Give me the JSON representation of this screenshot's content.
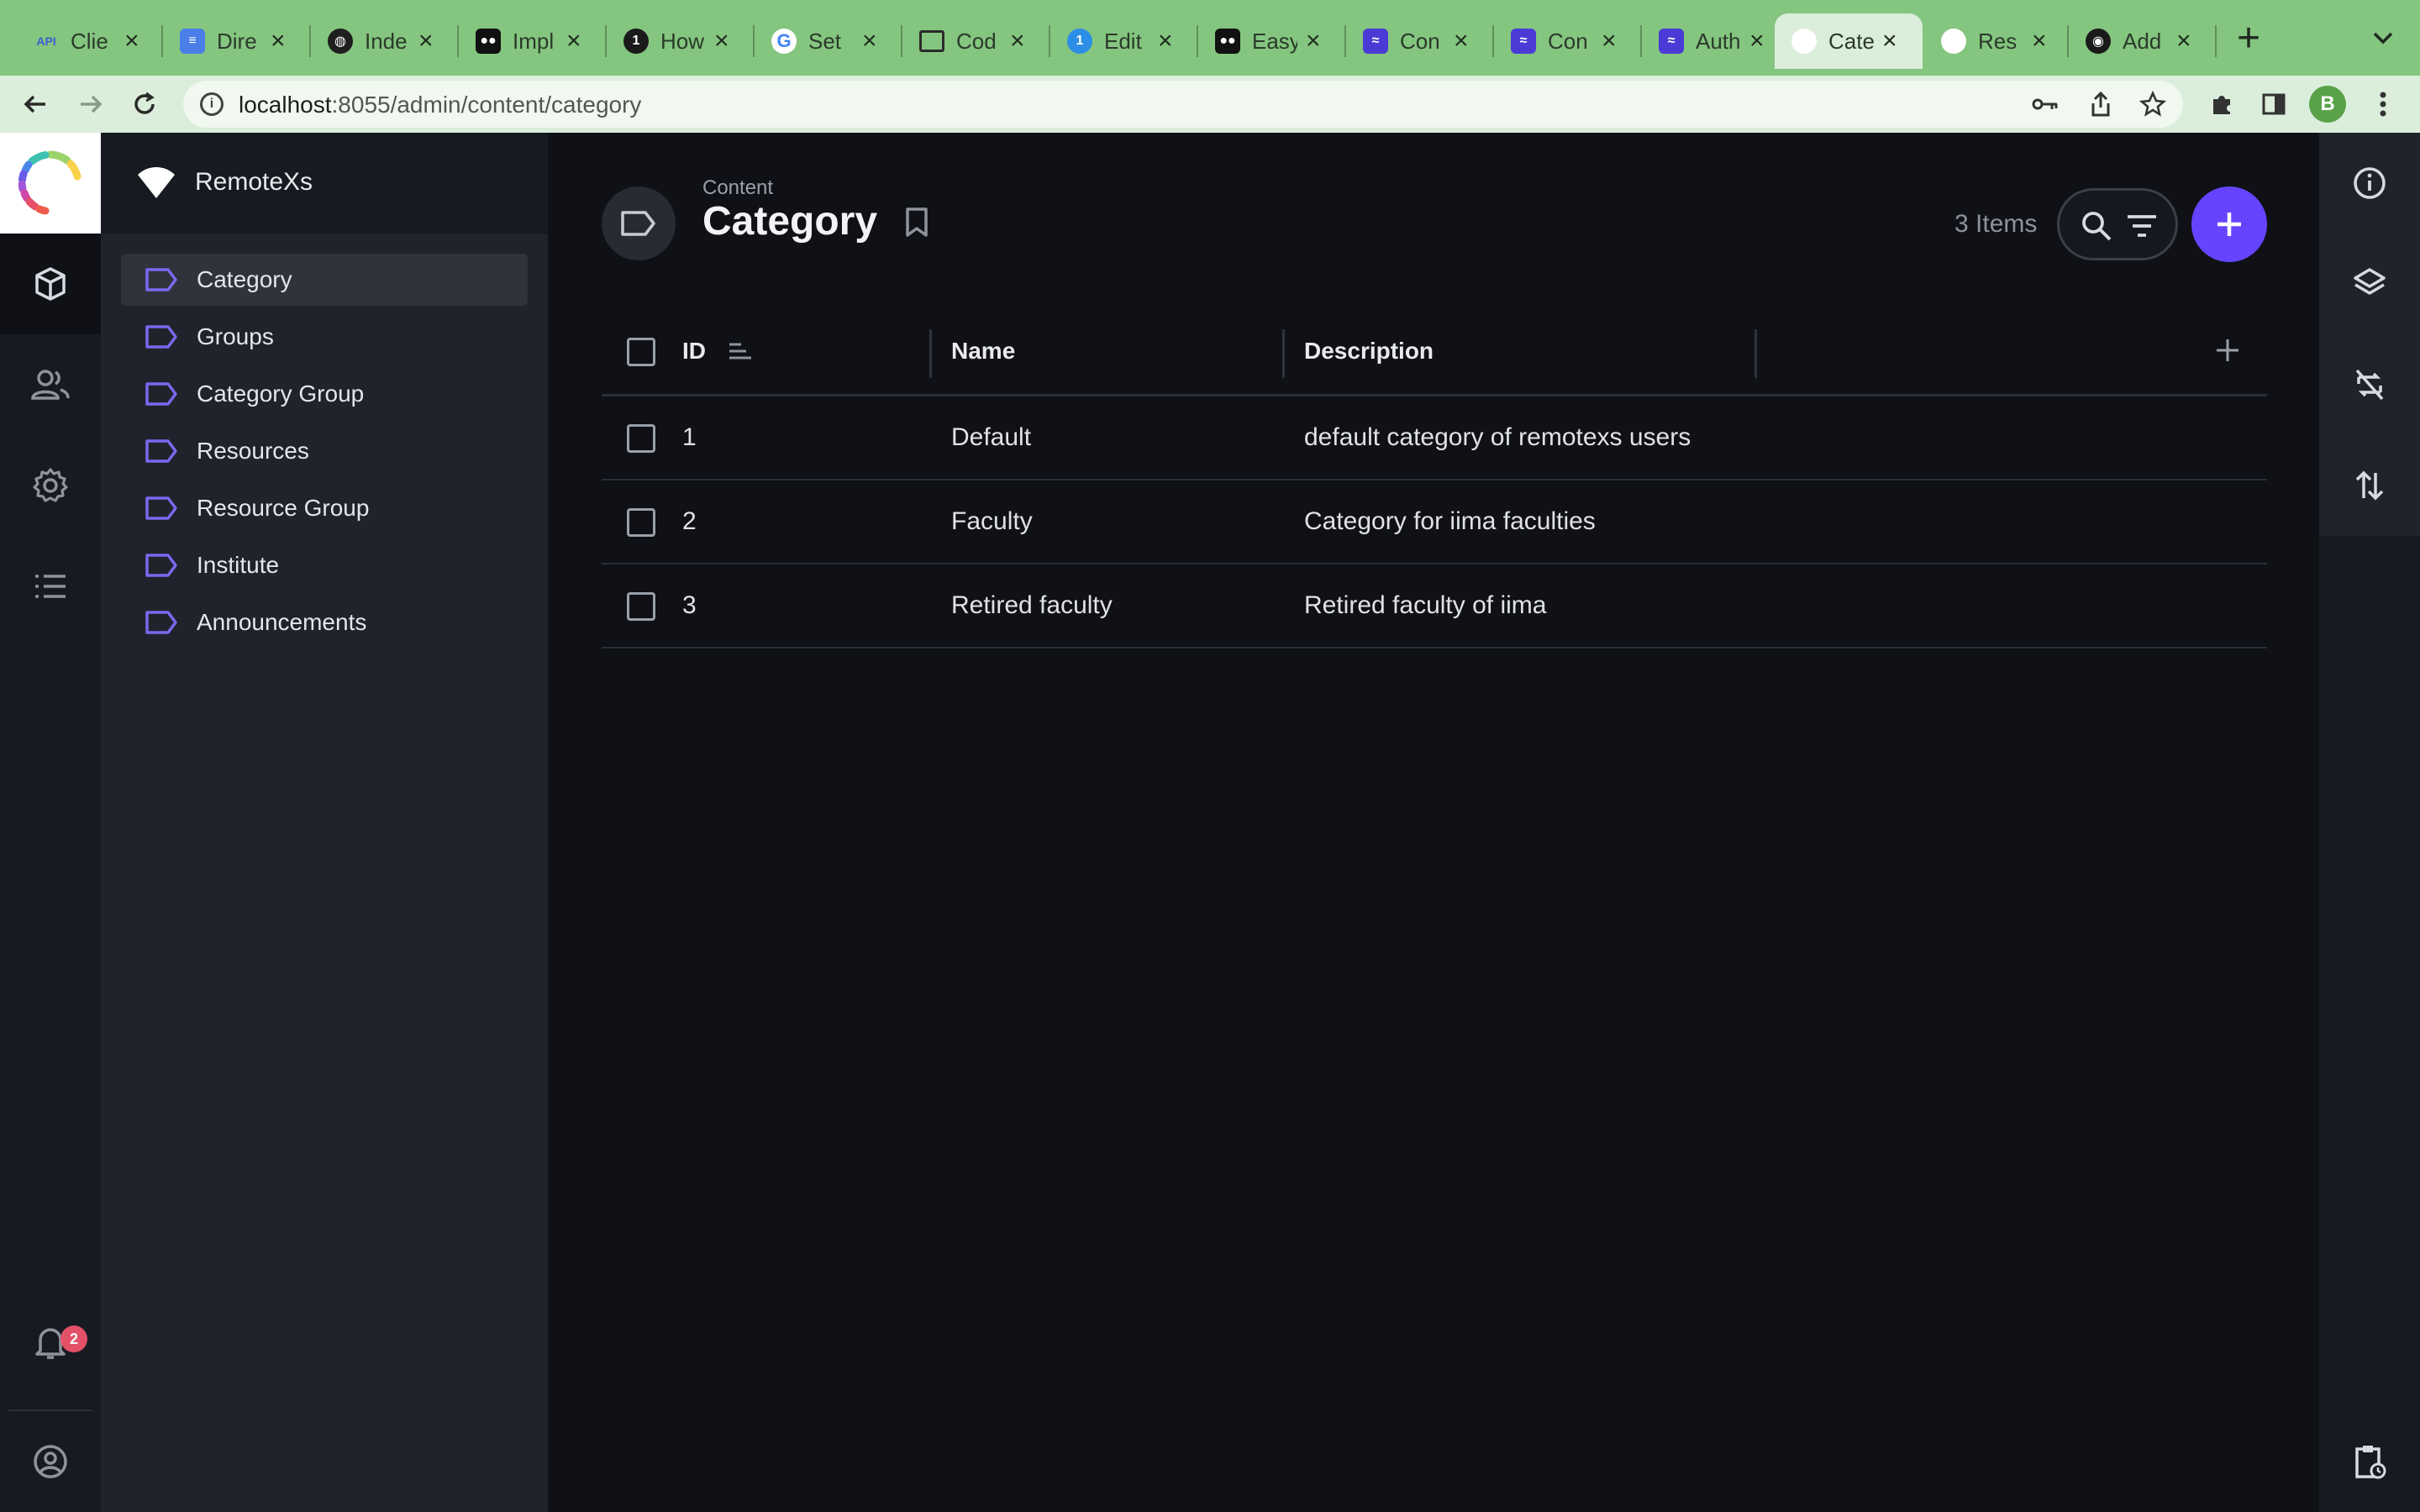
{
  "browser": {
    "tabs": [
      {
        "label": "Clie",
        "icon": "api-icon"
      },
      {
        "label": "Dire",
        "icon": "docs-icon"
      },
      {
        "label": "Inde",
        "icon": "globe-icon"
      },
      {
        "label": "Impl",
        "icon": "medium-icon"
      },
      {
        "label": "How",
        "icon": "1password-icon"
      },
      {
        "label": "Set",
        "icon": "google-icon"
      },
      {
        "label": "Cod",
        "icon": "square-icon"
      },
      {
        "label": "Edit",
        "icon": "1password-icon"
      },
      {
        "label": "Easy",
        "icon": "medium-icon"
      },
      {
        "label": "Con",
        "icon": "directus-icon"
      },
      {
        "label": "Con",
        "icon": "directus-icon"
      },
      {
        "label": "Auth",
        "icon": "directus-icon"
      },
      {
        "label": "Cate",
        "icon": "blank-icon",
        "active": true
      },
      {
        "label": "Res",
        "icon": "blank-icon"
      },
      {
        "label": "Add",
        "icon": "github-icon"
      }
    ],
    "url_host": "localhost",
    "url_rest": ":8055/admin/content/category",
    "profile_initial": "B",
    "colors": {
      "chrome": "#84c57f",
      "toolbar": "#dbeedb"
    }
  },
  "app": {
    "project_name": "RemoteXs",
    "notification_count": "2",
    "accent": "#6644ff"
  },
  "nav": {
    "items": [
      {
        "label": "Category",
        "active": true
      },
      {
        "label": "Groups"
      },
      {
        "label": "Category Group"
      },
      {
        "label": "Resources"
      },
      {
        "label": "Resource Group"
      },
      {
        "label": "Institute"
      },
      {
        "label": "Announcements"
      }
    ]
  },
  "header": {
    "breadcrumb": "Content",
    "title": "Category",
    "item_count": "3 Items"
  },
  "table": {
    "columns": [
      "ID",
      "Name",
      "Description"
    ],
    "rows": [
      {
        "id": "1",
        "name": "Default",
        "description": "default category of remotexs users"
      },
      {
        "id": "2",
        "name": "Faculty",
        "description": "Category for iima faculties"
      },
      {
        "id": "3",
        "name": "Retired faculty",
        "description": "Retired faculty of iima"
      }
    ]
  }
}
